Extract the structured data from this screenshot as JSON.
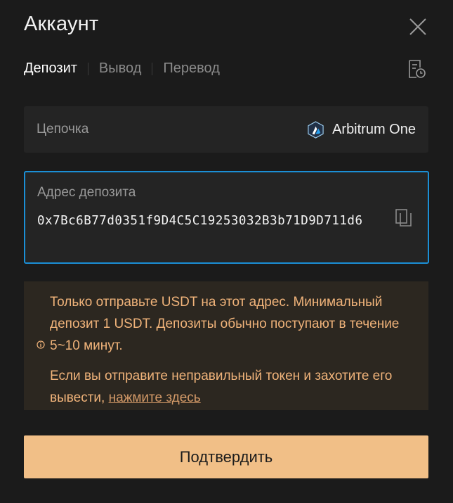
{
  "header": {
    "title": "Аккаунт"
  },
  "tabs": [
    {
      "label": "Депозит",
      "active": true
    },
    {
      "label": "Вывод",
      "active": false
    },
    {
      "label": "Перевод",
      "active": false
    }
  ],
  "icons": {
    "close": "close-icon",
    "history": "history-icon",
    "copy": "copy-icon",
    "info": "info-icon",
    "chain": "arbitrum-logo-icon"
  },
  "chain": {
    "label": "Цепочка",
    "value": "Arbitrum One"
  },
  "deposit_address": {
    "label": "Адрес депозита",
    "value": "0x7Bc6B77d0351f9D4C5C19253032B3b71D9D711d6"
  },
  "notice": {
    "line1": "Только отправьте USDT на этот адрес. Минимальный депозит 1 USDT. Депозиты обычно поступают в течение 5~10 минут.",
    "line2_prefix": "Если вы отправите неправильный токен и захотите его вывести, ",
    "line2_link": "нажмите здесь"
  },
  "confirm_label": "Подтвердить",
  "colors": {
    "background": "#1b1b1b",
    "accent": "#f1bf87",
    "focus_border": "#1b8fd6",
    "notice_text": "#f0b37a"
  }
}
